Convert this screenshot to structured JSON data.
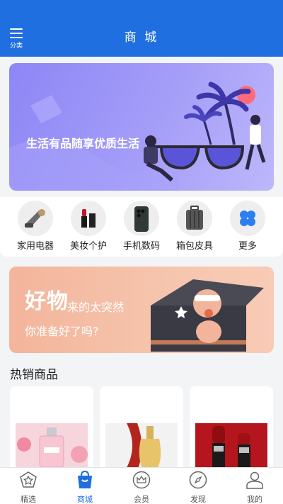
{
  "header": {
    "title": "商 城",
    "menu_label": "分类"
  },
  "banner": {
    "text": "生活有品随享优质生活"
  },
  "categories": [
    {
      "label": "家用电器",
      "icon": "vacuum-icon"
    },
    {
      "label": "美妆个护",
      "icon": "lipstick-icon"
    },
    {
      "label": "手机数码",
      "icon": "phone-icon"
    },
    {
      "label": "箱包皮具",
      "icon": "suitcase-icon"
    },
    {
      "label": "更多",
      "icon": "clover-icon"
    }
  ],
  "promo": {
    "big": "好物",
    "sub1": "来的太突然",
    "sub2": "你准备好了吗?"
  },
  "section": {
    "title": "热销商品"
  },
  "products": [
    {
      "image": "perfume-image"
    },
    {
      "image": "gold-perfume-image"
    },
    {
      "image": "lipstick-image"
    }
  ],
  "tabbar": {
    "tabs": [
      {
        "label": "精选",
        "icon": "star-icon"
      },
      {
        "label": "商城",
        "icon": "bag-icon",
        "active": true
      },
      {
        "label": "会员",
        "icon": "crown-icon"
      },
      {
        "label": "发现",
        "icon": "compass-icon"
      },
      {
        "label": "我的",
        "icon": "user-icon"
      }
    ]
  },
  "colors": {
    "primary": "#1f6fe0",
    "banner": "#9a93f7",
    "promo": "#f4bca3"
  }
}
